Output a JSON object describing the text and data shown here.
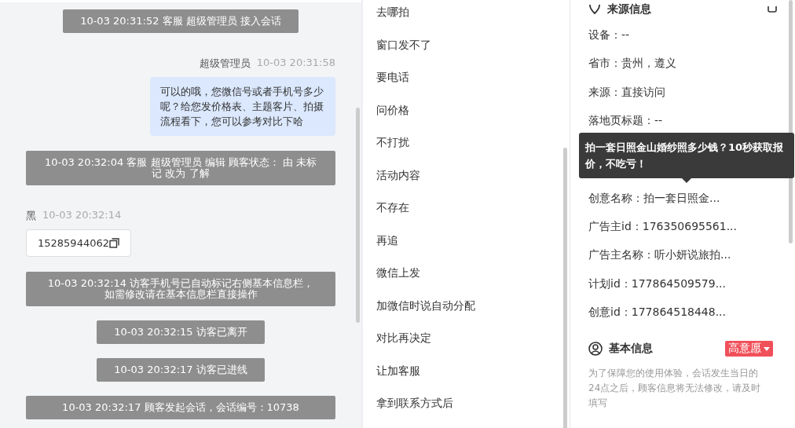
{
  "chat": {
    "messages": [
      {
        "kind": "system",
        "text": "10-03 20:31:52 客服 超级管理员 接入会话"
      },
      {
        "kind": "outgoing",
        "sender": "超级管理员",
        "time": "10-03 20:31:58",
        "text": "可以的哦，您微信号或者手机号多少呢？给您发价格表、主题客片、拍摄流程看下，您可以参考对比下哈"
      },
      {
        "kind": "system",
        "text": "10-03 20:32:04 客服 超级管理员 编辑 顾客状态： 由 未标记 改为 了解"
      },
      {
        "kind": "incoming",
        "sender": "黑",
        "time": "10-03 20:32:14",
        "text": "15285944062"
      },
      {
        "kind": "system",
        "text": "10-03 20:32:14 访客手机号已自动标记右侧基本信息栏，如需修改请在基本信息栏直接操作"
      },
      {
        "kind": "system",
        "text": "10-03 20:32:15 访客已离开"
      },
      {
        "kind": "system",
        "text": "10-03 20:32:17 访客已进线"
      },
      {
        "kind": "system",
        "text": "10-03 20:32:17 顾客发起会话，会话编号：10738"
      }
    ]
  },
  "quick_replies": [
    "去哪拍",
    "窗口发不了",
    "要电话",
    "问价格",
    "不打扰",
    "活动内容",
    "不存在",
    "再追",
    "微信上发",
    "加微信时说自动分配",
    "对比再决定",
    "让加客服",
    "拿到联系方式后"
  ],
  "source_info": {
    "title": "来源信息",
    "rows": [
      {
        "kind": "row",
        "text": "设备：--"
      },
      {
        "kind": "row",
        "text": "省市：贵州，遵义"
      },
      {
        "kind": "row",
        "text": "来源：直接访问"
      },
      {
        "kind": "row",
        "text": "落地页标题：--"
      },
      {
        "kind": "tooltip",
        "text": "拍一套日照金山婚纱照多少钱？10秒获取报价，不吃亏！"
      },
      {
        "kind": "row",
        "text": "创意名称：拍一套日照金..."
      },
      {
        "kind": "row",
        "text": "广告主id：176350695561..."
      },
      {
        "kind": "row",
        "text": "广告主名称：听小妍说旅拍..."
      },
      {
        "kind": "row",
        "text": "计划id：177864509579..."
      },
      {
        "kind": "row",
        "text": "创意id：177864518448..."
      }
    ]
  },
  "basic_info": {
    "title": "基本信息",
    "intent_tag": "高意愿",
    "note": "为了保障您的使用体验，会话发生当日的24点之后，顾客信息将无法修改，请及时填写"
  }
}
